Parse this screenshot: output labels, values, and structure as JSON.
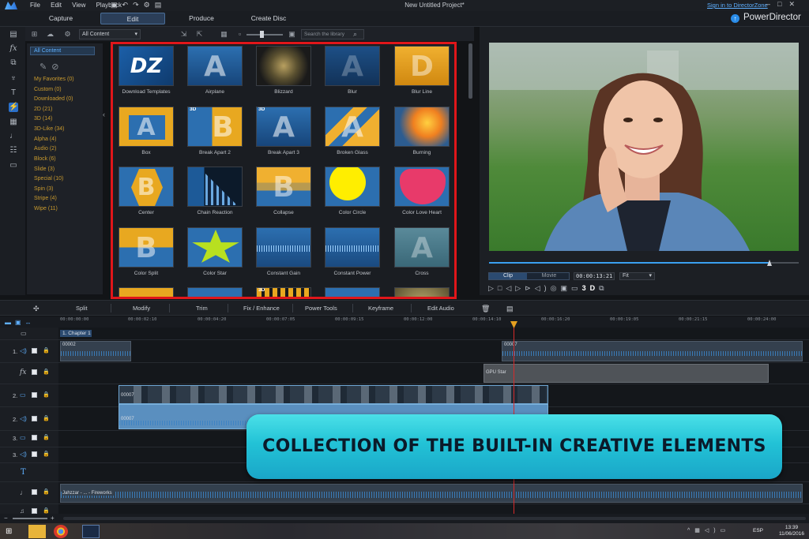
{
  "app": {
    "menu": [
      "File",
      "Edit",
      "View",
      "Playback"
    ],
    "project_title": "New Untitled Project*",
    "signin": "Sign in to DirectorZone",
    "brand": "PowerDirector"
  },
  "modes": [
    "Capture",
    "Edit",
    "Produce",
    "Create Disc"
  ],
  "library": {
    "filter_value": "All Content",
    "search_placeholder": "Search the library",
    "categories": [
      "All Content",
      "My Favorites  (0)",
      "Custom  (0)",
      "Downloaded  (0)",
      "2D  (21)",
      "3D  (14)",
      "3D-Like  (34)",
      "Alpha  (4)",
      "Audio  (2)",
      "Block  (6)",
      "Slide  (3)",
      "Special  (10)",
      "Spin  (3)",
      "Stripe  (4)",
      "Wipe  (11)"
    ],
    "items": [
      {
        "label": "Download Templates",
        "badge": ""
      },
      {
        "label": "Airplane",
        "badge": ""
      },
      {
        "label": "Blizzard",
        "badge": ""
      },
      {
        "label": "Blur",
        "badge": ""
      },
      {
        "label": "Blur Line",
        "badge": ""
      },
      {
        "label": "Box",
        "badge": ""
      },
      {
        "label": "Break Apart 2",
        "badge": "3D"
      },
      {
        "label": "Break Apart 3",
        "badge": "3D"
      },
      {
        "label": "Broken Glass",
        "badge": ""
      },
      {
        "label": "Burning",
        "badge": ""
      },
      {
        "label": "Center",
        "badge": ""
      },
      {
        "label": "Chain Reaction",
        "badge": ""
      },
      {
        "label": "Collapse",
        "badge": ""
      },
      {
        "label": "Color Circle",
        "badge": ""
      },
      {
        "label": "Color Love Heart",
        "badge": ""
      },
      {
        "label": "Color Split",
        "badge": ""
      },
      {
        "label": "Color Star",
        "badge": ""
      },
      {
        "label": "Constant Gain",
        "badge": ""
      },
      {
        "label": "Constant Power",
        "badge": ""
      },
      {
        "label": "Cross",
        "badge": ""
      }
    ],
    "tile_letters": {
      "dz": "DZ",
      "a": "A",
      "b": "B",
      "d": "D"
    },
    "extra_badge": "3D"
  },
  "preview": {
    "clip_label": "Clip",
    "movie_label": "Movie",
    "timecode": "00:00:13:21",
    "fit_value": "Fit",
    "mode_3d": "3D",
    "progress_fraction": 0.905
  },
  "edit_toolbar": [
    "Split",
    "Modify",
    "Trim",
    "Fix / Enhance",
    "Power Tools",
    "Keyframe",
    "Edit Audio"
  ],
  "timeline": {
    "ruler": [
      "00:00:00:00",
      "00:00:02:10",
      "00:00:04:20",
      "00:00:07:05",
      "00:00:09:15",
      "00:00:12:00",
      "00:00:14:10",
      "00:00:16:20",
      "00:00:19:05",
      "00:00:21:15",
      "00:00:24:00"
    ],
    "chapter": "1. Chapter 1",
    "track_labels": [
      "1.",
      "2.",
      "2.",
      "3.",
      "3."
    ],
    "clips": {
      "audio1a": "00002",
      "audio1b": "00007",
      "fx": "GPU Star",
      "video2": "00007",
      "audio2": "00007",
      "music": "Jahzzar - ... - Fireworks"
    }
  },
  "banner": "COLLECTION OF THE BUILT-IN CREATIVE ELEMENTS",
  "taskbar": {
    "lang": "ESP",
    "time": "13:39",
    "date": "11/06/2016"
  },
  "colors": {
    "accent": "#2a6fc8",
    "highlight_border": "#e0161a",
    "banner": "#22c2d6",
    "category_text": "#c99a2e"
  }
}
